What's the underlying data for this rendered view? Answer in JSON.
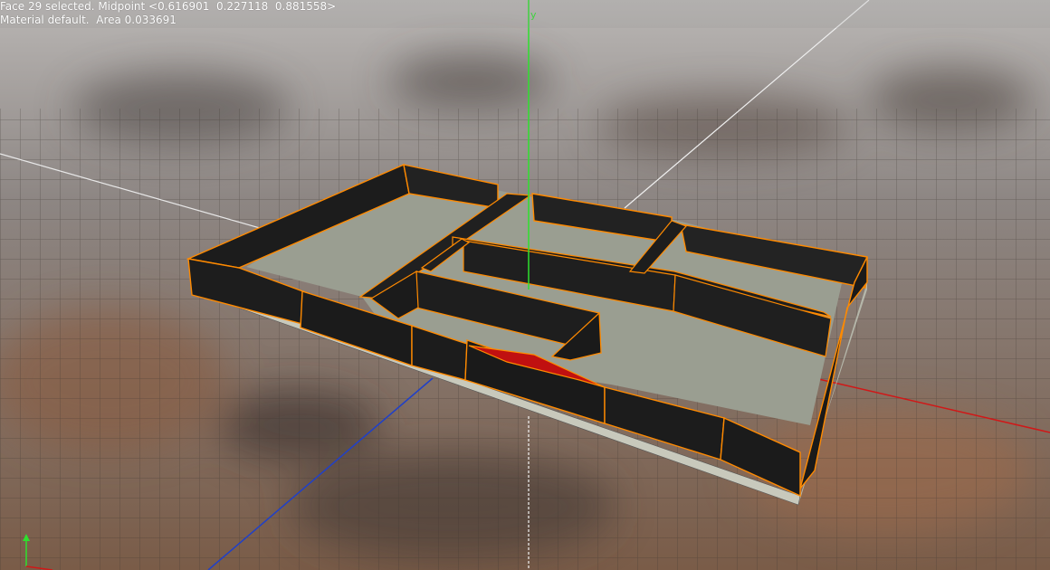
{
  "viewport": {
    "selection_info": "Face 29 selected. Midpoint <0.616901  0.227118  0.881558>",
    "material_info": "Material default.  Area 0.033691",
    "axis_y_label": "y",
    "colors": {
      "wall": "#1c1c1c",
      "floor": "#9a9e91",
      "selection_outline": "#ff8a00",
      "selected_face": "#c01010",
      "axis_x": "#d01818",
      "axis_y": "#2ee02e",
      "axis_z": "#2040c8",
      "grid": "#3a3430"
    }
  }
}
